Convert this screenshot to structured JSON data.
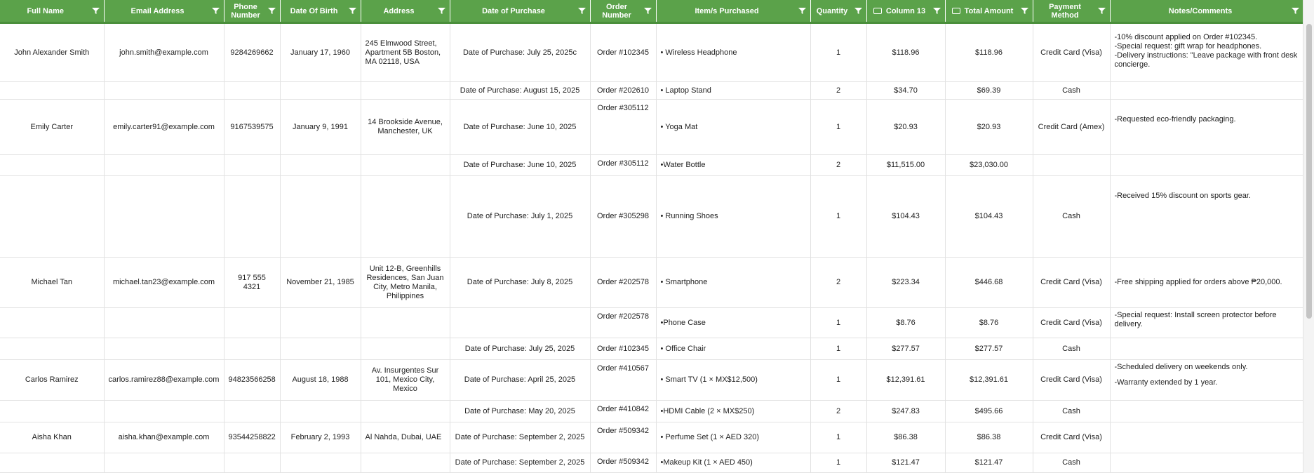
{
  "columns": [
    {
      "label": "Full Name"
    },
    {
      "label": "Email Address"
    },
    {
      "label": "Phone Number"
    },
    {
      "label": "Date Of Birth"
    },
    {
      "label": "Address"
    },
    {
      "label": "Date of Purchase"
    },
    {
      "label": "Order Number"
    },
    {
      "label": "Item/s Purchased"
    },
    {
      "label": "Quantity"
    },
    {
      "label": "Column 13"
    },
    {
      "label": "Total Amount"
    },
    {
      "label": "Payment Method"
    },
    {
      "label": "Notes/Comments"
    }
  ],
  "rows": [
    {
      "name": "John Alexander Smith",
      "email": "john.smith@example.com",
      "phone": "9284269662",
      "dob": "January 17, 1960",
      "address": "245 Elmwood Street, Apartment 5B Boston, MA 02118, USA",
      "purchase_date": "Date of Purchase: July 25, 2025c",
      "order": "Order #102345",
      "item": "• Wireless Headphone",
      "qty": "1",
      "col13": "$118.96",
      "total": "$118.96",
      "payment": "Credit Card (Visa)",
      "notes": [
        "-10% discount applied on Order #102345.",
        "-Special request: gift wrap for headphones.",
        "-Delivery instructions: \"Leave package with front desk concierge."
      ]
    },
    {
      "name": "",
      "email": "",
      "phone": "",
      "dob": "",
      "address": "",
      "purchase_date": "Date of Purchase: August 15, 2025",
      "order": "Order #202610",
      "item": "• Laptop Stand",
      "qty": "2",
      "col13": "$34.70",
      "total": "$69.39",
      "payment": "Cash",
      "notes": []
    },
    {
      "name": "Emily Carter",
      "email": "emily.carter91@example.com",
      "phone": "9167539575",
      "dob": "January 9, 1991",
      "address": "14 Brookside Avenue, Manchester, UK",
      "purchase_date": "Date of Purchase: June 10, 2025",
      "order": "Order #305112",
      "item": "• Yoga Mat",
      "qty": "1",
      "col13": "$20.93",
      "total": "$20.93",
      "payment": "Credit Card (Amex)",
      "notes": [
        "-Requested eco-friendly packaging."
      ]
    },
    {
      "name": "",
      "email": "",
      "phone": "",
      "dob": "",
      "address": "",
      "purchase_date": "Date of Purchase: June 10, 2025",
      "order": "Order #305112",
      "item": "•Water Bottle",
      "qty": "2",
      "col13": "$11,515.00",
      "total": "$23,030.00",
      "payment": "",
      "notes": []
    },
    {
      "name": "",
      "email": "",
      "phone": "",
      "dob": "",
      "address": "",
      "purchase_date": "Date of Purchase: July 1, 2025",
      "order": "Order #305298",
      "item": "• Running Shoes",
      "qty": "1",
      "col13": "$104.43",
      "total": "$104.43",
      "payment": "Cash",
      "notes": [
        "-Received 15% discount on sports gear."
      ]
    },
    {
      "name": "Michael Tan",
      "email": "michael.tan23@example.com",
      "phone": "917 555 4321",
      "dob": "November 21, 1985",
      "address": "Unit 12-B, Greenhills Residences, San Juan City, Metro Manila, Philippines",
      "purchase_date": "Date of Purchase: July 8, 2025",
      "order": "Order #202578",
      "item": "• Smartphone",
      "qty": "2",
      "col13": "$223.34",
      "total": "$446.68",
      "payment": "Credit Card (Visa)",
      "notes": [
        "-Free shipping applied for orders above ₱20,000."
      ]
    },
    {
      "name": "",
      "email": "",
      "phone": "",
      "dob": "",
      "address": "",
      "purchase_date": "",
      "order": "Order #202578",
      "item": "•Phone Case",
      "qty": "1",
      "col13": "$8.76",
      "total": "$8.76",
      "payment": "Credit Card (Visa)",
      "notes": [
        "-Special request: Install screen protector before delivery."
      ]
    },
    {
      "name": "",
      "email": "",
      "phone": "",
      "dob": "",
      "address": "",
      "purchase_date": "Date of Purchase: July 25, 2025",
      "order": "Order #102345",
      "item": "• Office Chair",
      "qty": "1",
      "col13": "$277.57",
      "total": "$277.57",
      "payment": "Cash",
      "notes": []
    },
    {
      "name": "Carlos Ramirez",
      "email": "carlos.ramirez88@example.com",
      "phone": "94823566258",
      "dob": "August 18, 1988",
      "address": "Av. Insurgentes Sur 101, Mexico City, Mexico",
      "purchase_date": "Date of Purchase: April 25, 2025",
      "order": "Order #410567",
      "item": "• Smart TV (1 × MX$12,500)",
      "qty": "1",
      "col13": "$12,391.61",
      "total": "$12,391.61",
      "payment": "Credit Card (Visa)",
      "notes": [
        "-Scheduled delivery on weekends only.",
        "-Warranty extended by 1 year."
      ]
    },
    {
      "name": "",
      "email": "",
      "phone": "",
      "dob": "",
      "address": "",
      "purchase_date": "Date of Purchase: May 20, 2025",
      "order": "Order #410842",
      "item": "•HDMI Cable (2 × MX$250)",
      "qty": "2",
      "col13": "$247.83",
      "total": "$495.66",
      "payment": "Cash",
      "notes": []
    },
    {
      "name": "Aisha Khan",
      "email": "aisha.khan@example.com",
      "phone": "93544258822",
      "dob": "February 2, 1993",
      "address": "Al Nahda, Dubai, UAE",
      "purchase_date": "Date of Purchase: September 2, 2025",
      "order": "Order #509342",
      "item": "• Perfume Set (1 × AED 320)",
      "qty": "1",
      "col13": "$86.38",
      "total": "$86.38",
      "payment": "Credit Card (Visa)",
      "notes": []
    },
    {
      "name": "",
      "email": "",
      "phone": "",
      "dob": "",
      "address": "",
      "purchase_date": "Date of Purchase: September 2, 2025",
      "order": "Order #509342",
      "item": "•Makeup Kit (1 × AED 450)",
      "qty": "1",
      "col13": "$121.47",
      "total": "$121.47",
      "payment": "Cash",
      "notes": []
    }
  ],
  "colors": {
    "header_bg": "#5ba24a",
    "header_text": "#ffffff",
    "grid": "#e2e2e2"
  },
  "icons": {
    "filter": "filter-icon",
    "column_type": "currency-chip-icon"
  }
}
